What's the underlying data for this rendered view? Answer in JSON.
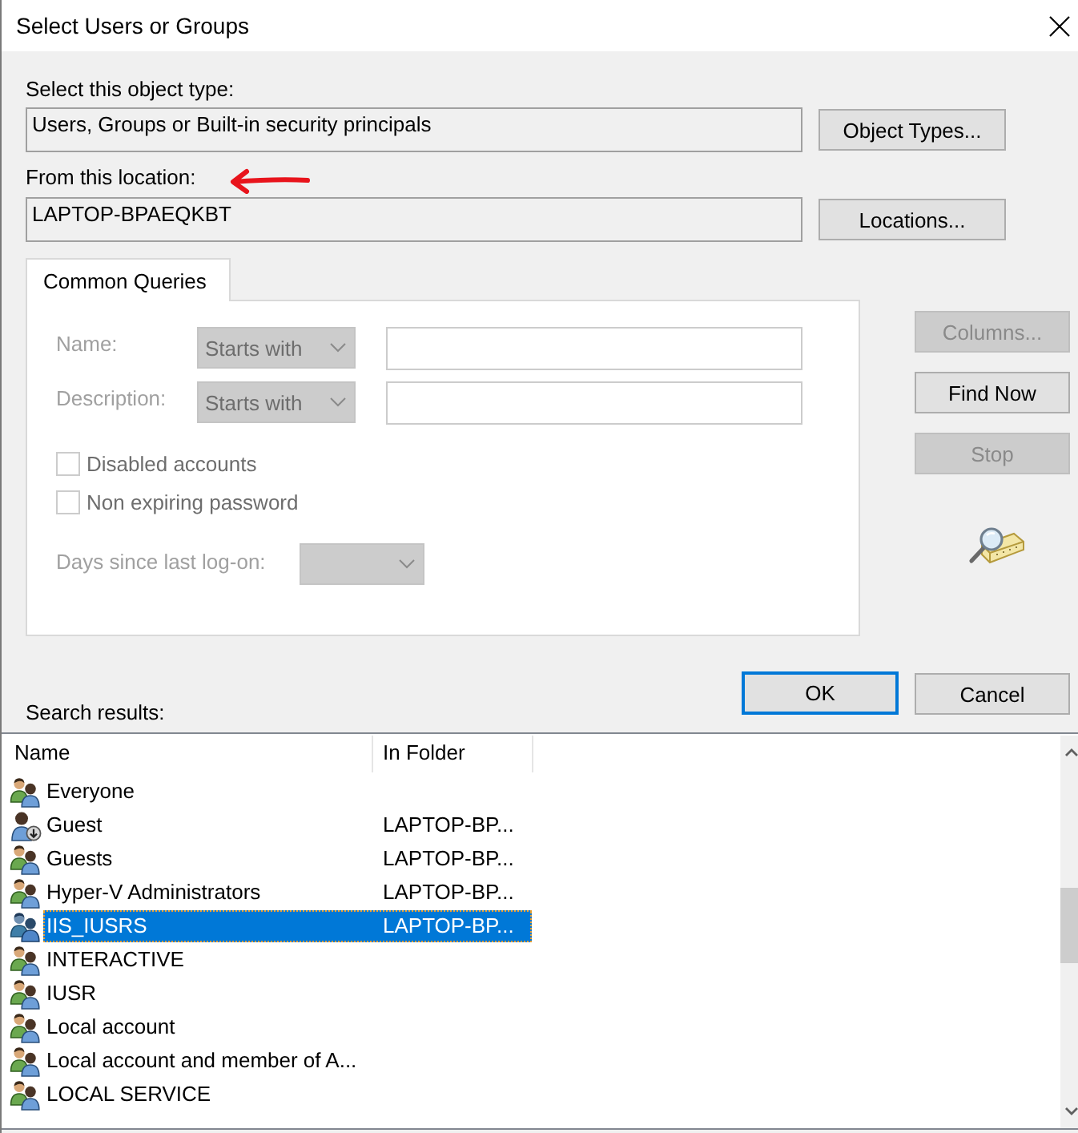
{
  "window": {
    "title": "Select Users or Groups"
  },
  "object_type": {
    "label": "Select this object type:",
    "value": "Users, Groups or Built-in security principals",
    "button": "Object Types..."
  },
  "location": {
    "label": "From this location:",
    "value": "LAPTOP-BPAEQKBT",
    "button": "Locations..."
  },
  "tabs": [
    {
      "label": "Common Queries",
      "selected": true
    }
  ],
  "queries": [
    {
      "label": "Name:",
      "operator": "Starts with",
      "disabled": true
    },
    {
      "label": "Description:",
      "operator": "Starts with",
      "disabled": true
    }
  ],
  "checkboxes": [
    {
      "label": "Disabled accounts",
      "checked": false,
      "disabled": true
    },
    {
      "label": "Non expiring password",
      "checked": false,
      "disabled": true
    }
  ],
  "days_since_logon": {
    "label": "Days since last log-on:",
    "disabled": true
  },
  "side_buttons": [
    {
      "label": "Columns...",
      "disabled": true
    },
    {
      "label": "Find Now",
      "disabled": false
    },
    {
      "label": "Stop",
      "disabled": true
    }
  ],
  "search_results": {
    "label": "Search results:"
  },
  "dialog_buttons": [
    {
      "label": "OK",
      "default": true
    },
    {
      "label": "Cancel",
      "default": false
    }
  ],
  "results": {
    "columns": [
      "Name",
      "In Folder"
    ],
    "rows": [
      {
        "kind": "group",
        "name": "Everyone",
        "selected": false
      },
      {
        "kind": "user",
        "name": "Guest",
        "folder": "LAPTOP-BP...",
        "selected": false
      },
      {
        "kind": "group",
        "name": "Guests",
        "folder": "LAPTOP-BP...",
        "selected": false
      },
      {
        "kind": "group",
        "name": "Hyper-V Administrators",
        "folder": "LAPTOP-BP...",
        "selected": false
      },
      {
        "kind": "group",
        "name": "IIS_IUSRS",
        "folder": "LAPTOP-BP...",
        "selected": true
      },
      {
        "kind": "group",
        "name": "INTERACTIVE",
        "selected": false
      },
      {
        "kind": "group",
        "name": "IUSR",
        "selected": false
      },
      {
        "kind": "group",
        "name": "Local account",
        "selected": false
      },
      {
        "kind": "group",
        "name": "Local account and member of A...",
        "selected": false
      },
      {
        "kind": "group",
        "name": "LOCAL SERVICE",
        "selected": false
      }
    ]
  }
}
